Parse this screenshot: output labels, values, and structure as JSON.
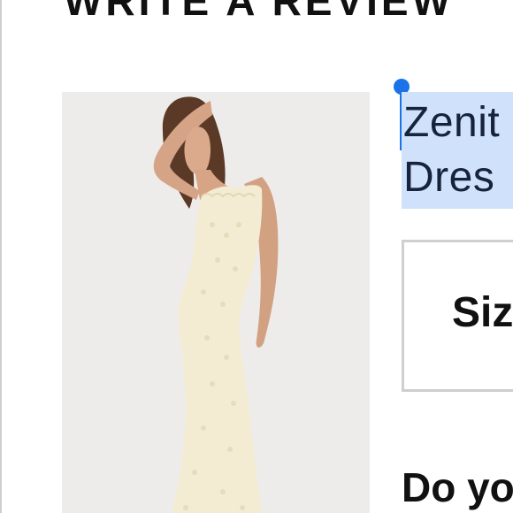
{
  "page": {
    "heading": "WRITE A REVIEW"
  },
  "product": {
    "name_line1": "Zenit",
    "name_line2": "Dres",
    "image_alt": "Cream lace maxi dress worn by model"
  },
  "form": {
    "size_label": "Siz",
    "question_label": "Do yo"
  },
  "colors": {
    "selection_highlight": "#cfe1fb",
    "caret": "#1a73e8",
    "heading_text": "#111111"
  }
}
